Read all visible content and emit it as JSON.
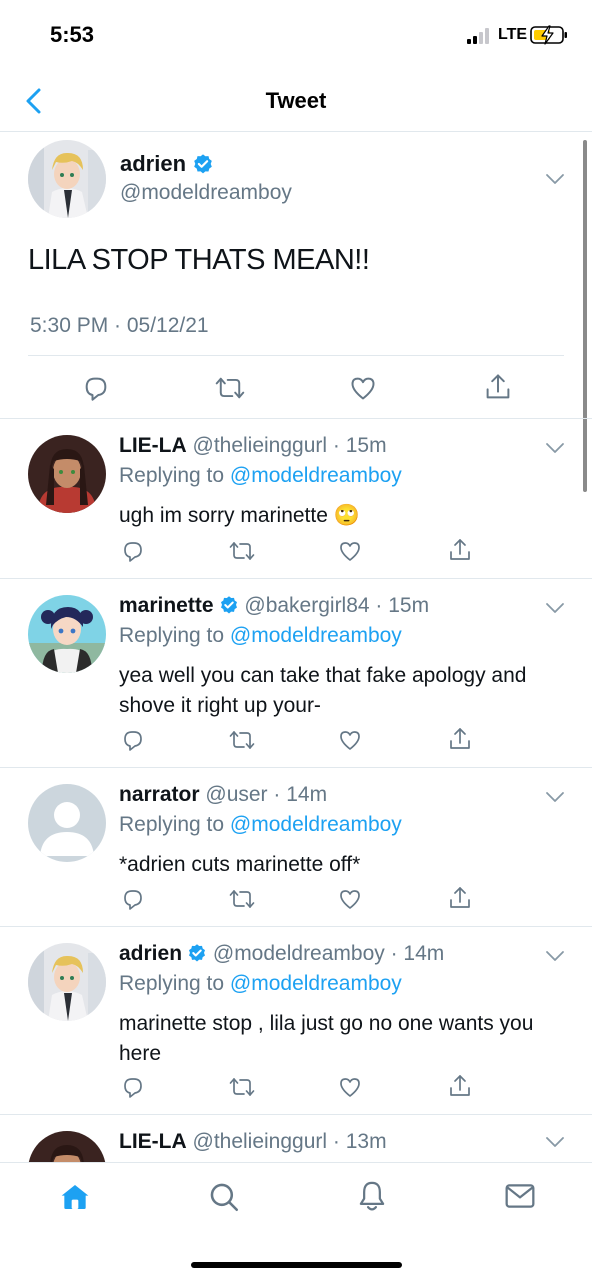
{
  "status_bar": {
    "time": "5:53",
    "network": "LTE"
  },
  "nav": {
    "title": "Tweet"
  },
  "main_tweet": {
    "name": "adrien",
    "handle": "@modeldreamboy",
    "text": "LILA STOP THATS MEAN!!",
    "timestamp": "5:30 PM · 05/12/21"
  },
  "replies": [
    {
      "name": "LIE-LA",
      "verified": false,
      "handle_time": "@thelieinggurl · 15m",
      "replying_prefix": "Replying to",
      "mention": "@modeldreamboy",
      "text": "ugh im sorry marinette 🙄"
    },
    {
      "name": "marinette",
      "verified": true,
      "handle_time": "@bakergirl84 · 15m",
      "replying_prefix": "Replying to",
      "mention": "@modeldreamboy",
      "text": "yea well you can take that fake apology and shove it right up your-"
    },
    {
      "name": "narrator",
      "verified": false,
      "handle_time": "@user · 14m",
      "replying_prefix": "Replying to",
      "mention": "@modeldreamboy",
      "text": "*adrien cuts marinette off*"
    },
    {
      "name": "adrien",
      "verified": true,
      "handle_time": "@modeldreamboy · 14m",
      "replying_prefix": "Replying to",
      "mention": "@modeldreamboy",
      "text": "marinette stop , lila just go no one wants you here"
    },
    {
      "name": "LIE-LA",
      "verified": false,
      "handle_time": "@thelieinggurl · 13m"
    }
  ],
  "tab_bar": {
    "items": [
      "home-icon",
      "search-icon",
      "notifications-icon",
      "messages-icon"
    ],
    "active": "home-icon"
  },
  "colors": {
    "accent": "#1da1f2",
    "secondary_text": "#657786",
    "divider": "#e1e8ed"
  }
}
